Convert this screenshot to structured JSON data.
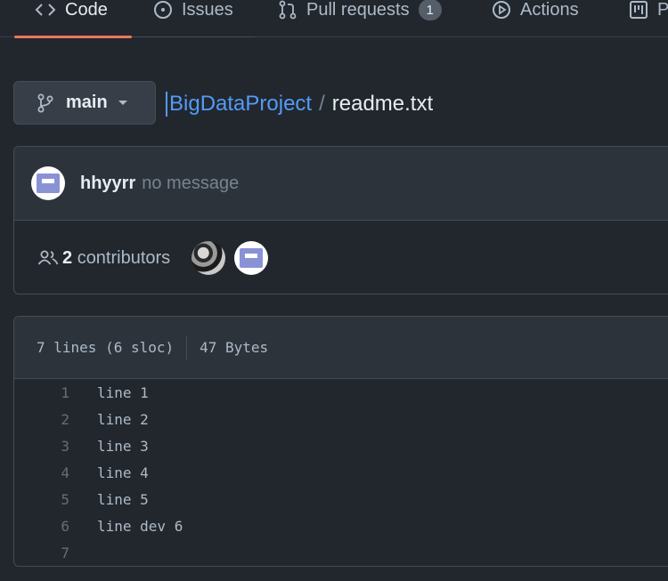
{
  "tabs": [
    {
      "label": "Code",
      "icon": "code-icon",
      "active": true
    },
    {
      "label": "Issues",
      "icon": "issue-icon",
      "active": false
    },
    {
      "label": "Pull requests",
      "icon": "pull-request-icon",
      "active": false,
      "counter": "1"
    },
    {
      "label": "Actions",
      "icon": "play-icon",
      "active": false
    },
    {
      "label": "P",
      "icon": "project-icon",
      "active": false
    }
  ],
  "branch": {
    "name": "main",
    "icon": "git-branch-icon"
  },
  "breadcrumb": {
    "repo": "BigDataProject",
    "separator": "/",
    "file": "readme.txt"
  },
  "commit": {
    "author": "hhyyrr",
    "message": "no message"
  },
  "contributors": {
    "count": "2",
    "label": "contributors",
    "icon": "people-icon"
  },
  "file": {
    "lines_info": "7 lines (6 sloc)",
    "size": "47 Bytes",
    "lines": [
      {
        "num": "1",
        "text": "line 1"
      },
      {
        "num": "2",
        "text": "line 2"
      },
      {
        "num": "3",
        "text": "line 3"
      },
      {
        "num": "4",
        "text": "line 4"
      },
      {
        "num": "5",
        "text": "line 5"
      },
      {
        "num": "6",
        "text": "line dev 6"
      },
      {
        "num": "7",
        "text": ""
      }
    ]
  },
  "colors": {
    "accent": "#ec775c",
    "link": "#539bf5",
    "background": "#22272e"
  }
}
